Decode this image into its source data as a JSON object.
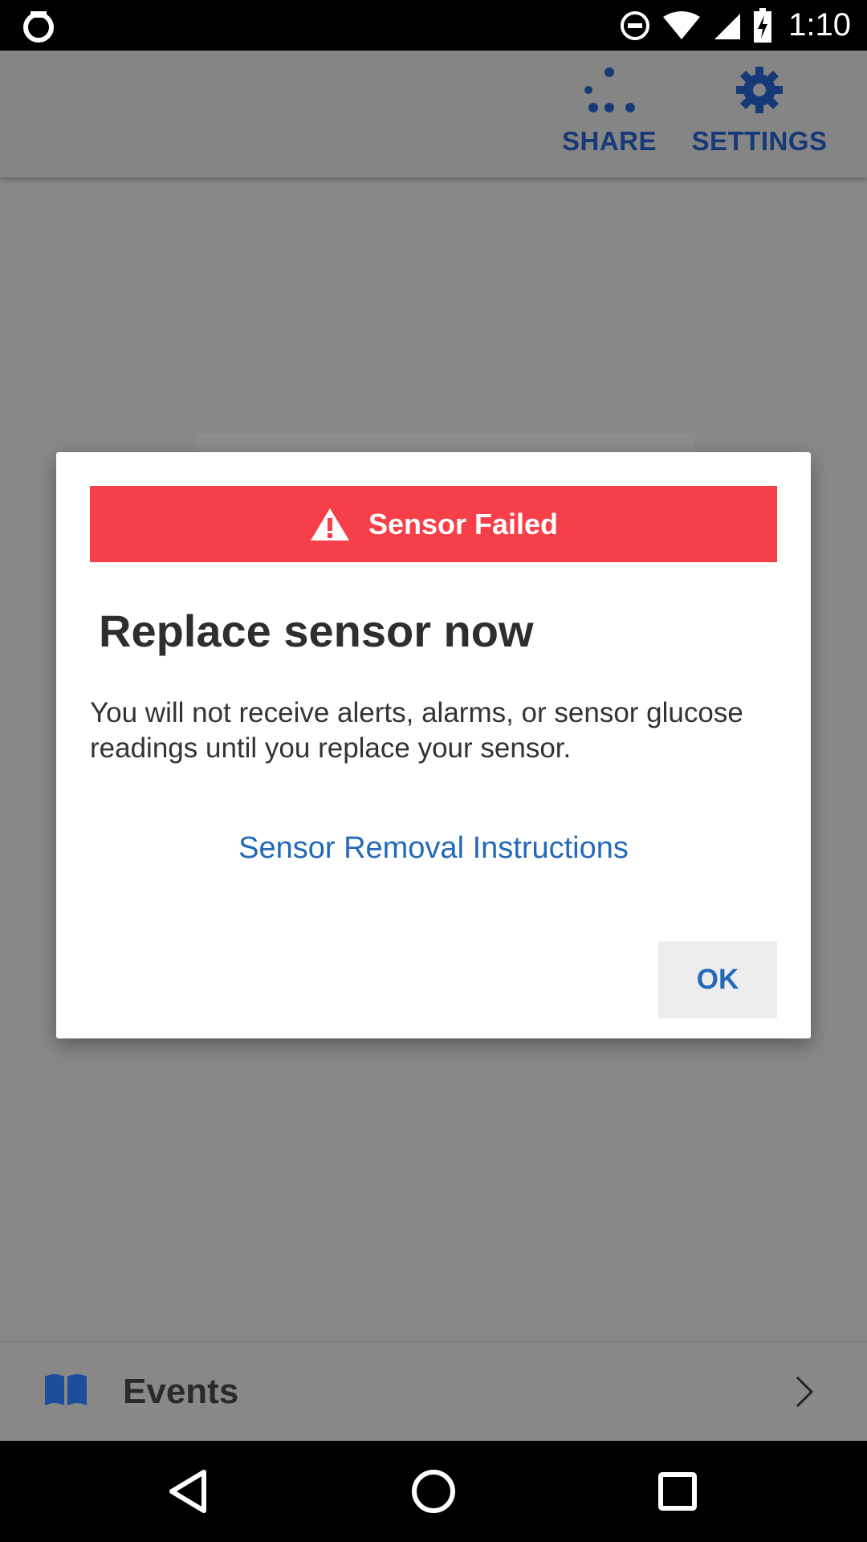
{
  "status_bar": {
    "time": "1:10",
    "icons": [
      "notification-ring-icon",
      "do-not-disturb-icon",
      "wifi-icon",
      "cell-signal-icon",
      "battery-charging-icon"
    ]
  },
  "app_bar": {
    "share_label": "SHARE",
    "settings_label": "SETTINGS"
  },
  "dialog": {
    "banner_title": "Sensor Failed",
    "heading": "Replace sensor now",
    "body": "You will not receive alerts, alarms, or sensor glucose readings until you replace your sensor.",
    "link": "Sensor Removal Instructions",
    "ok_label": "OK"
  },
  "events": {
    "label": "Events"
  },
  "colors": {
    "banner": "#f63f48",
    "accent": "#2369b8",
    "app_bar_icon": "#163a78",
    "scrim": "#888888"
  }
}
